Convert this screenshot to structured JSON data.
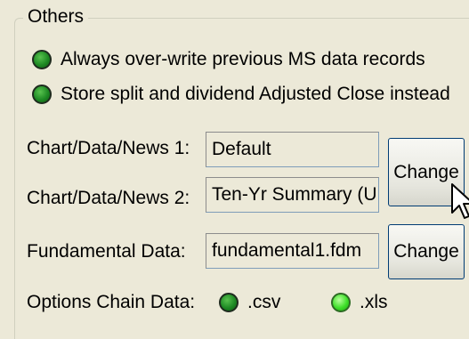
{
  "group": {
    "title": "Others"
  },
  "options": [
    {
      "label": "Always over-write previous MS data records",
      "selected": true
    },
    {
      "label": "Store split and dividend Adjusted Close instead",
      "selected": true
    }
  ],
  "fields": [
    {
      "label": "Chart/Data/News 1:",
      "value": "Default"
    },
    {
      "label": "Chart/Data/News 2:",
      "value": "Ten-Yr Summary (U"
    },
    {
      "label": "Fundamental Data:",
      "value": "fundamental1.fdm"
    }
  ],
  "buttons": {
    "change_chart": "Change",
    "change_fundamental": "Change"
  },
  "options_chain": {
    "label": "Options Chain Data:",
    "choices": [
      {
        "label": ".csv",
        "selected": false
      },
      {
        "label": ".xls",
        "selected": true
      }
    ]
  },
  "icons": [
    "radio-button-icon",
    "mouse-pointer-icon"
  ]
}
